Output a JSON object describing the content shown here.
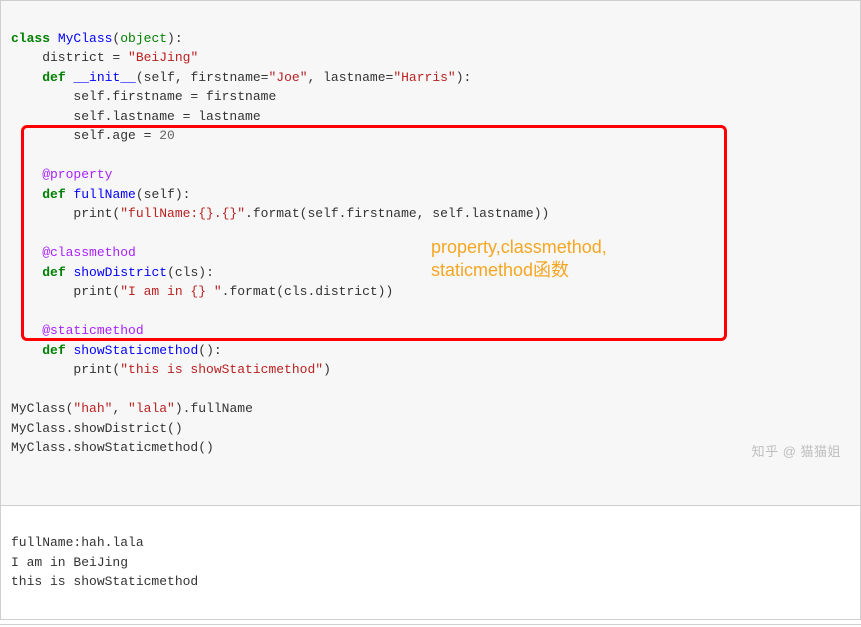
{
  "code": {
    "l1": {
      "a": "class ",
      "b": "MyClass",
      "c": "(",
      "d": "object",
      "e": "):"
    },
    "l2": {
      "a": "    district = ",
      "s": "\"BeiJing\""
    },
    "l3": {
      "a": "    ",
      "k": "def ",
      "f": "__init__",
      "p": "(self, firstname=",
      "s1": "\"Joe\"",
      "c1": ", lastname=",
      "s2": "\"Harris\"",
      "e": "):"
    },
    "l4": "        self.firstname = firstname",
    "l5": "        self.lastname = lastname",
    "l6": {
      "a": "        self.age = ",
      "n": "20"
    },
    "blank": "",
    "l7": "    @property",
    "l8": {
      "a": "    ",
      "k": "def ",
      "f": "fullName",
      "p": "(self):"
    },
    "l9": {
      "a": "        print(",
      "s": "\"fullName:{}.{}\"",
      "r": ".format(self.firstname, self.lastname))"
    },
    "l10": "    @classmethod",
    "l11": {
      "a": "    ",
      "k": "def ",
      "f": "showDistrict",
      "p": "(cls):"
    },
    "l12": {
      "a": "        print(",
      "s": "\"I am in {} \"",
      "r": ".format(cls.district))"
    },
    "l13": "    @staticmethod",
    "l14": {
      "a": "    ",
      "k": "def ",
      "f": "showStaticmethod",
      "p": "():"
    },
    "l15": {
      "a": "        print(",
      "s": "\"this is showStaticmethod\"",
      "r": ")"
    },
    "l16": {
      "a": "MyClass(",
      "s1": "\"hah\"",
      "c": ", ",
      "s2": "\"lala\"",
      "r": ").fullName"
    },
    "l17": "MyClass.showDistrict()",
    "l18": "MyClass.showStaticmethod()"
  },
  "output": {
    "o1": "fullName:hah.lala",
    "o2": "I am in BeiJing ",
    "o3": "this is showStaticmethod"
  },
  "annotation": {
    "line1": "property,classmethod,",
    "line2": "staticmethod函数"
  },
  "watermark": "知乎 @ 猫猫姐"
}
